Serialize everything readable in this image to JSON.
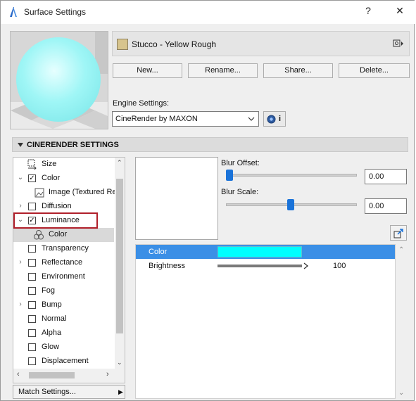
{
  "window": {
    "title": "Surface Settings",
    "help": "?",
    "close": "✕"
  },
  "surface": {
    "name": "Stucco - Yellow Rough",
    "swatch_color": "#d7c48d",
    "preview_sphere_color": "#9ff6f6"
  },
  "buttons": {
    "new": "New...",
    "rename": "Rename...",
    "share": "Share...",
    "delete": "Delete..."
  },
  "engine": {
    "label": "Engine Settings:",
    "value": "CineRender by MAXON",
    "info_glyph": "i"
  },
  "section": {
    "title": "CINERENDER SETTINGS"
  },
  "tree": {
    "items": [
      {
        "label": "Size",
        "kind": "icon"
      },
      {
        "label": "Color",
        "checked": true,
        "expanded": true
      },
      {
        "label": "Image (Textured Re",
        "kind": "image-child"
      },
      {
        "label": "Diffusion",
        "checked": false,
        "expandable": true
      },
      {
        "label": "Luminance",
        "checked": true,
        "expanded": true
      },
      {
        "label": "Color",
        "kind": "selected-child"
      },
      {
        "label": "Transparency",
        "checked": false
      },
      {
        "label": "Reflectance",
        "checked": false,
        "expandable": true
      },
      {
        "label": "Environment",
        "checked": false
      },
      {
        "label": "Fog",
        "checked": false
      },
      {
        "label": "Bump",
        "checked": false,
        "expandable": true
      },
      {
        "label": "Normal",
        "checked": false
      },
      {
        "label": "Alpha",
        "checked": false
      },
      {
        "label": "Glow",
        "checked": false
      },
      {
        "label": "Displacement",
        "checked": false
      }
    ],
    "match_settings": "Match Settings..."
  },
  "blur": {
    "offset_label": "Blur Offset:",
    "offset_value": "0.00",
    "offset_level": 0.0,
    "scale_label": "Blur Scale:",
    "scale_value": "0.00",
    "scale_level": 0.5
  },
  "properties": {
    "rows": [
      {
        "label": "Color",
        "swatch": "#00ffff"
      },
      {
        "label": "Brightness",
        "value": "100",
        "level": 1.0
      }
    ]
  },
  "colors": {
    "accent": "#3b8fe6",
    "highlight_frame": "#b01f2a"
  }
}
